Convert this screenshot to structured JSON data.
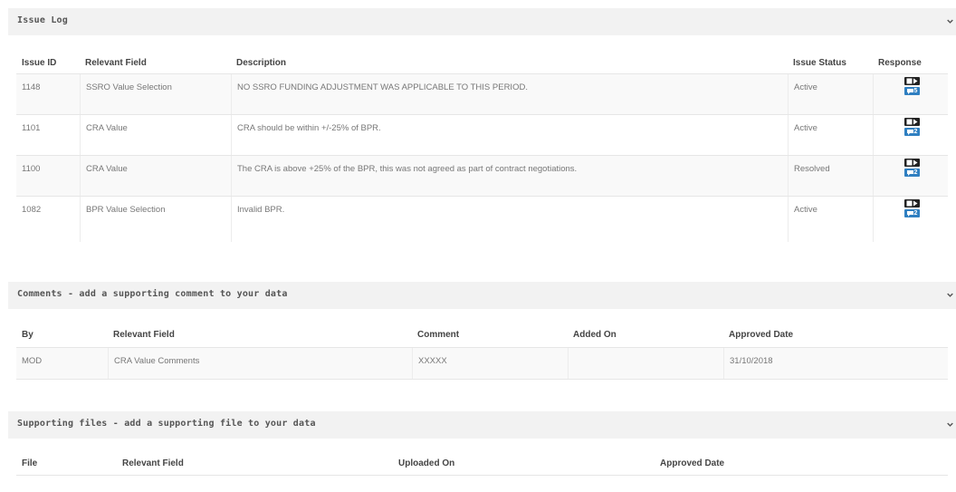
{
  "colors": {
    "panel_header_bg": "#f2f2f2",
    "stripe_bg": "#f9f9f9",
    "badge_dark": "#222222",
    "badge_blue": "#2f7fc1"
  },
  "issue_log": {
    "title": "Issue Log",
    "collapse_icon": "chevron-down-icon",
    "columns": [
      "Issue ID",
      "Relevant Field",
      "Description",
      "Issue Status",
      "Response"
    ],
    "rows": [
      {
        "id": "1148",
        "field": "SSRO Value Selection",
        "description": "NO SSRO FUNDING ADJUSTMENT WAS APPLICABLE TO THIS PERIOD.",
        "status": "Active",
        "comment_count": "5"
      },
      {
        "id": "1101",
        "field": "CRA Value",
        "description": "CRA should be within +/-25% of BPR.",
        "status": "Active",
        "comment_count": "2"
      },
      {
        "id": "1100",
        "field": "CRA Value",
        "description": "The CRA is above +25% of the BPR, this was not agreed as part of contract negotiations.",
        "status": "Resolved",
        "comment_count": "2"
      },
      {
        "id": "1082",
        "field": "BPR Value Selection",
        "description": "Invalid BPR.",
        "status": "Active",
        "comment_count": "2"
      }
    ]
  },
  "comments": {
    "title": "Comments - add a supporting comment to your data",
    "collapse_icon": "chevron-down-icon",
    "columns": [
      "By",
      "Relevant Field",
      "Comment",
      "Added On",
      "Approved Date"
    ],
    "rows": [
      {
        "by": "MOD",
        "field": "CRA Value Comments",
        "comment": "XXXXX",
        "added_on": "",
        "approved": "31/10/2018"
      }
    ]
  },
  "files": {
    "title": "Supporting files - add a supporting file to your data",
    "collapse_icon": "chevron-down-icon",
    "columns": [
      "File",
      "Relevant Field",
      "Uploaded On",
      "Approved Date"
    ]
  }
}
